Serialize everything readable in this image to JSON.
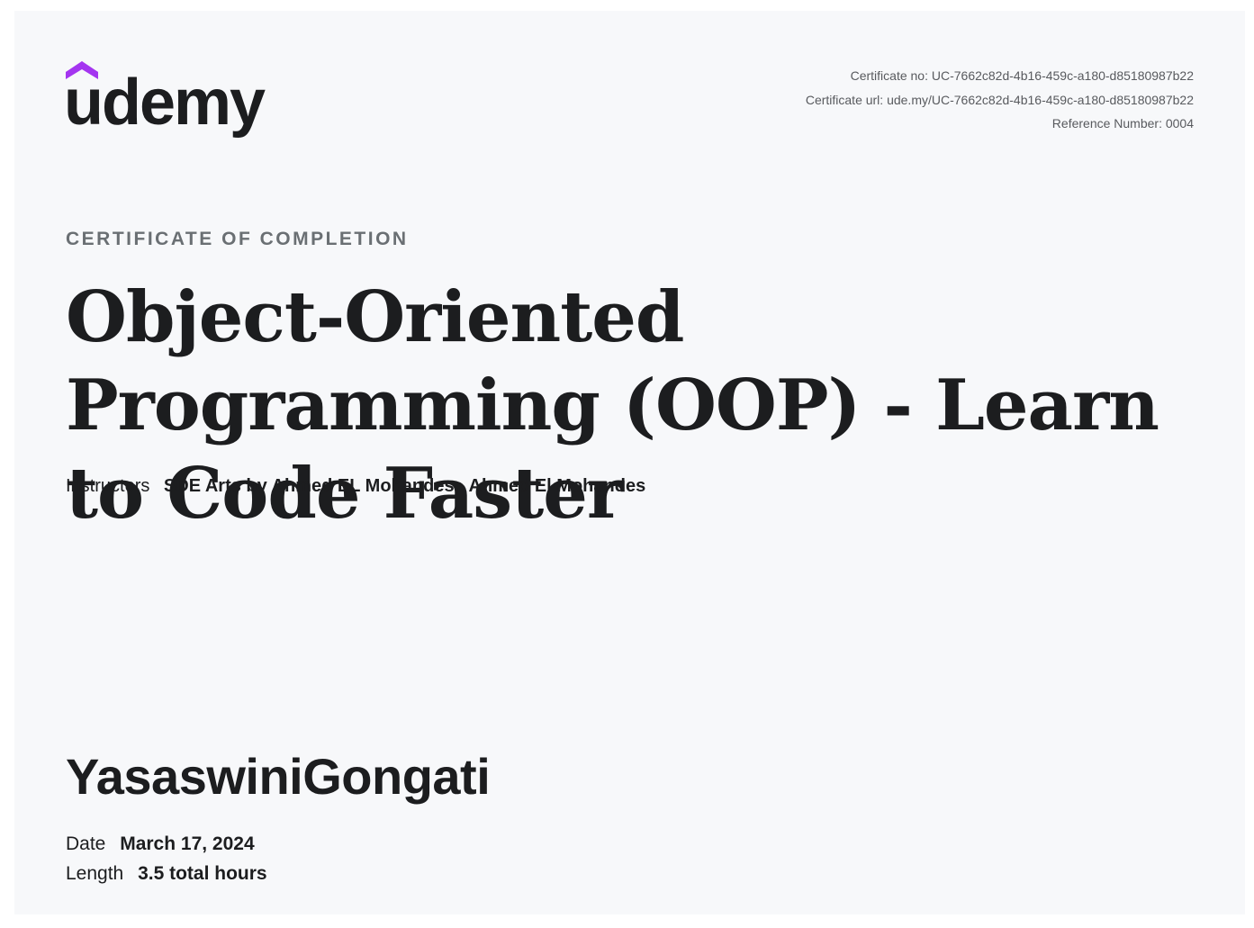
{
  "brand": {
    "logo_text": "udemy",
    "accent_color": "#a435f0",
    "text_color": "#1c1d1f"
  },
  "meta": {
    "certificate_no": "Certificate no: UC-7662c82d-4b16-459c-a180-d85180987b22",
    "certificate_url": "Certificate url: ude.my/UC-7662c82d-4b16-459c-a180-d85180987b22",
    "reference_number": "Reference Number: 0004"
  },
  "certificate": {
    "heading": "CERTIFICATE OF COMPLETION",
    "course_title": "Object-Oriented Programming (OOP) - Learn to Code Faster",
    "instructors_label": "Instructors",
    "instructors_value": "SDE Arts by Ahmed EL Mohandes,  Ahmed El Mohandes",
    "student_name": "YasaswiniGongati",
    "date_label": "Date",
    "date_value": "March 17, 2024",
    "length_label": "Length",
    "length_value": "3.5 total hours"
  }
}
